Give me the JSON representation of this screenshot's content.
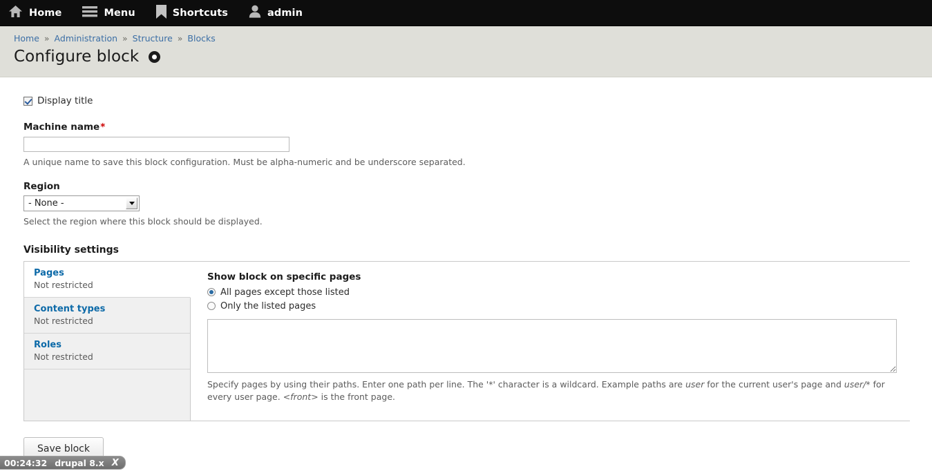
{
  "toolbar": {
    "items": [
      {
        "label": "Home",
        "icon": "home-icon"
      },
      {
        "label": "Menu",
        "icon": "hamburger-icon"
      },
      {
        "label": "Shortcuts",
        "icon": "bookmark-icon"
      },
      {
        "label": "admin",
        "icon": "user-icon"
      }
    ]
  },
  "breadcrumb": {
    "items": [
      "Home",
      "Administration",
      "Structure",
      "Blocks"
    ],
    "separator": "»"
  },
  "page": {
    "title": "Configure block"
  },
  "form": {
    "display_title": {
      "label": "Display title",
      "checked": true
    },
    "machine_name": {
      "label": "Machine name",
      "required_marker": "*",
      "value": "",
      "placeholder": "",
      "description": "A unique name to save this block configuration. Must be alpha-numeric and be underscore separated."
    },
    "region": {
      "label": "Region",
      "selected": "- None -",
      "options": [
        "- None -"
      ],
      "description": "Select the region where this block should be displayed."
    },
    "save_label": "Save block"
  },
  "visibility": {
    "heading": "Visibility settings",
    "tabs": [
      {
        "title": "Pages",
        "summary": "Not restricted",
        "selected": true
      },
      {
        "title": "Content types",
        "summary": "Not restricted",
        "selected": false
      },
      {
        "title": "Roles",
        "summary": "Not restricted",
        "selected": false
      }
    ],
    "pane": {
      "title": "Show block on specific pages",
      "radios": [
        {
          "label": "All pages except those listed",
          "checked": true
        },
        {
          "label": "Only the listed pages",
          "checked": false
        }
      ],
      "textarea_value": "",
      "description_parts": {
        "p1": "Specify pages by using their paths. Enter one path per line. The '*' character is a wildcard. Example paths are ",
        "em1": "user",
        "p2": " for the current user's page and ",
        "em2": "user/*",
        "p3": " for every user page. ",
        "em3": "<front>",
        "p4": " is the front page."
      }
    }
  },
  "status_bar": {
    "time": "00:24:32",
    "label": "drupal 8.x",
    "close_glyph": "X"
  }
}
